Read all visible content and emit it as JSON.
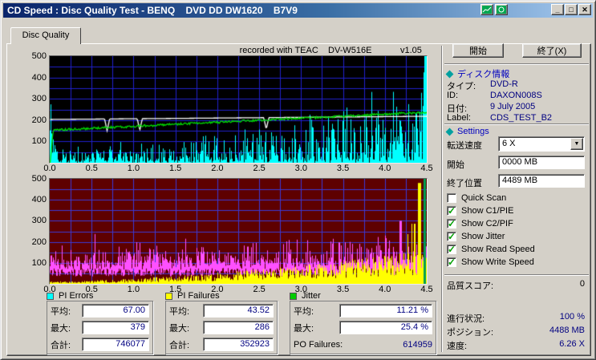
{
  "window": {
    "title": "CD Speed : Disc Quality Test - BENQ    DVD DD DW1620    B7V9",
    "buttons": {
      "minimize": "_",
      "maximize": "□",
      "close": "✕"
    }
  },
  "tabs": [
    {
      "label": "Disc Quality"
    }
  ],
  "chart_header": {
    "recorded_with": "recorded with TEAC    DV-W516E",
    "version": "v1.05"
  },
  "actions": {
    "start": "開始",
    "exit": "終了(X)"
  },
  "disc_info": {
    "title": "ディスク情報",
    "fields": [
      {
        "label": "タイプ:",
        "value": "DVD-R"
      },
      {
        "label": "ID:",
        "value": "DAXON008S"
      },
      {
        "label": "日付:",
        "value": "9 July 2005"
      },
      {
        "label": "Label:",
        "value": "CDS_TEST_B2"
      }
    ]
  },
  "settings": {
    "title": "Settings",
    "speed": {
      "label": "転送速度",
      "value": "6 X"
    },
    "start": {
      "label": "開始",
      "value": "0000 MB"
    },
    "end": {
      "label": "終了位置",
      "value": "4489 MB"
    },
    "checkboxes": [
      {
        "label": "Quick Scan",
        "checked": false
      },
      {
        "label": "Show C1/PIE",
        "checked": true
      },
      {
        "label": "Show C2/PIF",
        "checked": true
      },
      {
        "label": "Show Jitter",
        "checked": true
      },
      {
        "label": "Show Read Speed",
        "checked": true
      },
      {
        "label": "Show Write Speed",
        "checked": true
      }
    ]
  },
  "quality": {
    "label": "品質スコア:",
    "value": "0"
  },
  "progress": [
    {
      "label": "進行状況:",
      "value": "100 %"
    },
    {
      "label": "ポジション:",
      "value": "4488 MB"
    },
    {
      "label": "速度:",
      "value": "6.26 X"
    }
  ],
  "stats": {
    "pi_errors": {
      "title": "PI Errors",
      "rows": [
        {
          "label": "平均:",
          "value": "67.00"
        },
        {
          "label": "最大:",
          "value": "379"
        },
        {
          "label": "合計:",
          "value": "746077"
        }
      ]
    },
    "pi_failures": {
      "title": "PI Failures",
      "rows": [
        {
          "label": "平均:",
          "value": "43.52"
        },
        {
          "label": "最大:",
          "value": "286"
        },
        {
          "label": "合計:",
          "value": "352923"
        }
      ]
    },
    "jitter": {
      "title": "Jitter",
      "rows": [
        {
          "label": "平均:",
          "value": "11.21 %"
        },
        {
          "label": "最大:",
          "value": "25.4 %"
        }
      ],
      "po_failures": {
        "label": "PO Failures:",
        "value": "614959"
      }
    }
  },
  "chart_data": [
    {
      "type": "area",
      "name": "pi-errors-and-speed",
      "bg": "#000000",
      "grid": {
        "color": "#2121cd",
        "x_step": 0.25,
        "y_step": 50
      },
      "x_range": [
        0,
        4.5
      ],
      "y_range": [
        0,
        500
      ],
      "x_ticks": [
        0,
        0.5,
        1,
        1.5,
        2,
        2.5,
        3,
        3.5,
        4,
        4.5
      ],
      "y_ticks": [
        100,
        200,
        300,
        400,
        500
      ],
      "series": [
        {
          "name": "PI Errors",
          "color": "#00ffff",
          "style": "spikes",
          "avg": 67,
          "max": 379,
          "seed": 7
        },
        {
          "name": "Write Speed",
          "color": "#ffffff",
          "style": "line",
          "from": 203,
          "to": 218,
          "dips": [
            0.68,
            1.07,
            2.58
          ],
          "dip_depth": 55,
          "seed": 5
        },
        {
          "name": "Read Speed",
          "color": "#00e000",
          "style": "line",
          "from": 152,
          "to": 237,
          "noise": 5,
          "start_zero": true,
          "seed": 3
        }
      ]
    },
    {
      "type": "area",
      "name": "pi-failures-and-jitter",
      "bg": "#5e0000",
      "grid": {
        "color": "#3a3ad8",
        "x_step": 0.25,
        "y_step": 50
      },
      "x_range": [
        0,
        4.5
      ],
      "y_range": [
        0,
        500
      ],
      "x_ticks": [
        0,
        0.5,
        1,
        1.5,
        2,
        2.5,
        3,
        3.5,
        4,
        4.5
      ],
      "y_ticks": [
        100,
        200,
        300,
        400,
        500
      ],
      "series": [
        {
          "name": "Jitter",
          "color": "#ff50ff",
          "style": "band",
          "seed": 11
        },
        {
          "name": "PI Failures",
          "color": "#ffff00",
          "style": "rising-spikes",
          "avg": 44,
          "max": 286,
          "spike_x": 0.98,
          "seed": 13
        },
        {
          "name": "end-marker",
          "color": "#00a050",
          "style": "vline",
          "x": 4.47
        }
      ]
    }
  ]
}
